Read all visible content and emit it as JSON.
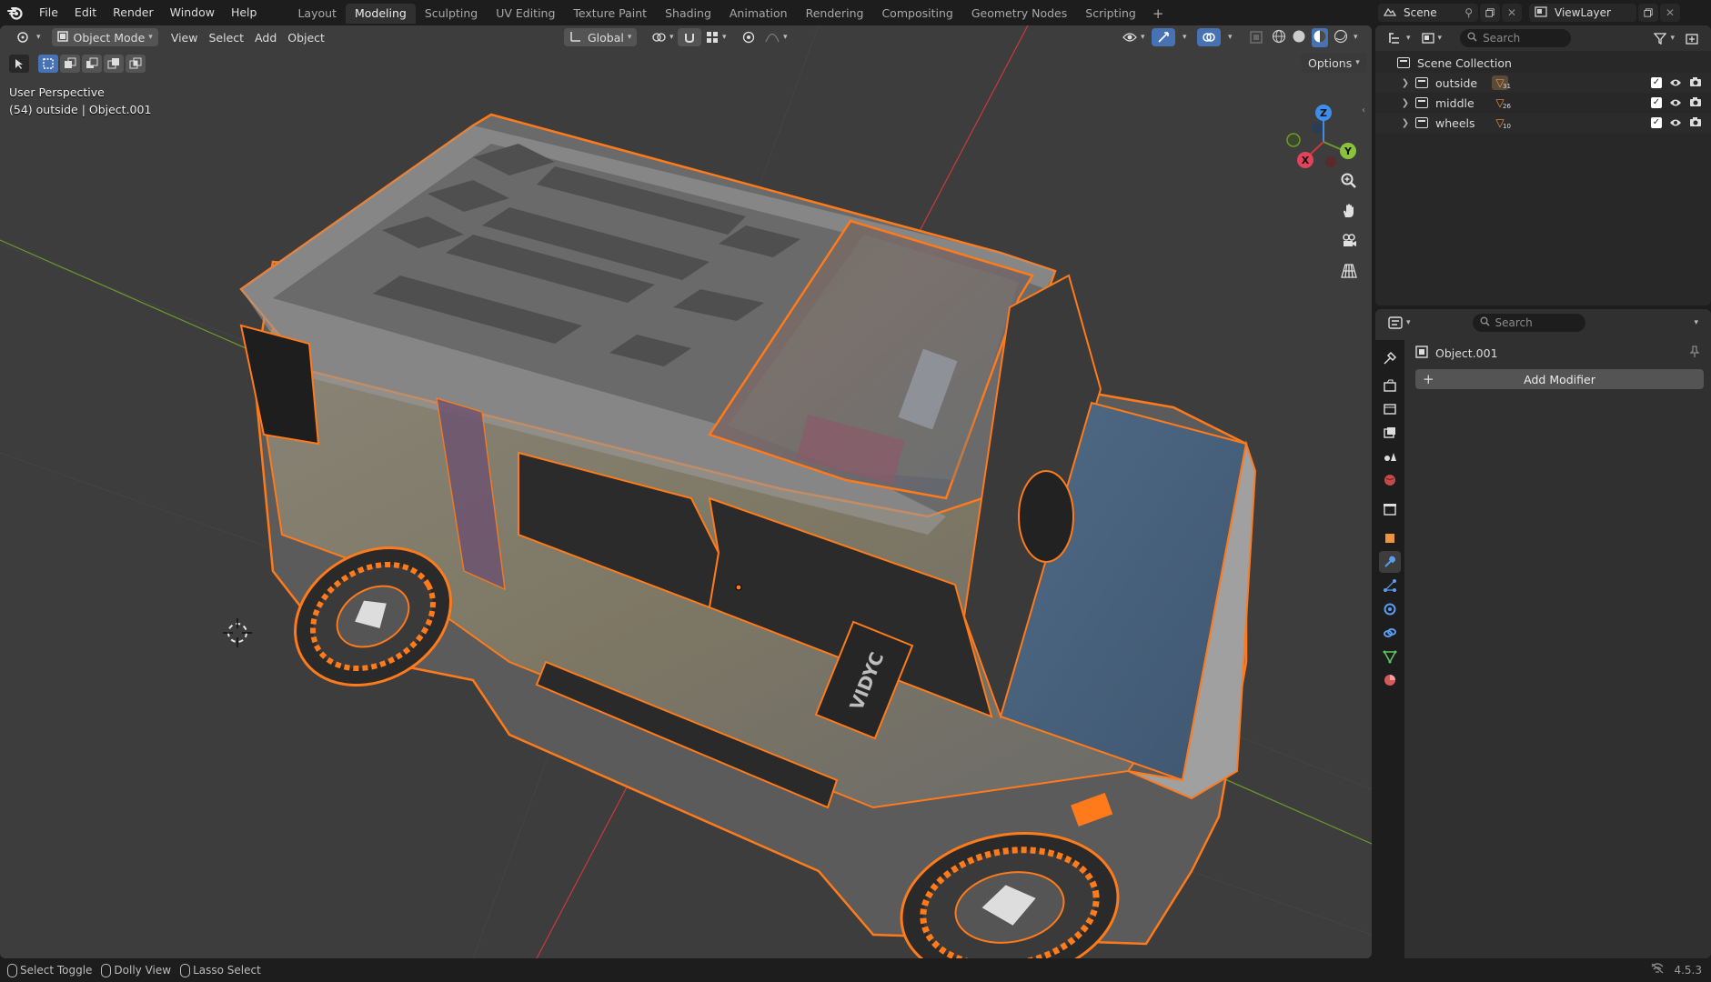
{
  "topbar": {
    "menus": [
      "File",
      "Edit",
      "Render",
      "Window",
      "Help"
    ],
    "workspaces": [
      "Layout",
      "Modeling",
      "Sculpting",
      "UV Editing",
      "Texture Paint",
      "Shading",
      "Animation",
      "Rendering",
      "Compositing",
      "Geometry Nodes",
      "Scripting"
    ],
    "active_workspace": "Modeling",
    "scene_name": "Scene",
    "view_layer": "ViewLayer"
  },
  "viewport": {
    "mode": "Object Mode",
    "menus": [
      "View",
      "Select",
      "Add",
      "Object"
    ],
    "transform_orientation": "Global",
    "options_label": "Options",
    "perspective_label": "User Perspective",
    "object_info": "(54) outside | Object.001",
    "gizmo_axes": [
      "Z",
      "Y",
      "X"
    ],
    "model_decal": "VIDYC",
    "colors": {
      "background": "#3d3d3d",
      "selection": "#ff7a1a",
      "x_axis": "#c93a3a",
      "y_axis": "#6d9a2a",
      "z_axis": "#3d8ee8"
    }
  },
  "outliner": {
    "search_placeholder": "Search",
    "root": "Scene Collection",
    "collections": [
      {
        "name": "outside",
        "count": "31"
      },
      {
        "name": "middle",
        "count": "26"
      },
      {
        "name": "wheels",
        "count": "10"
      }
    ]
  },
  "properties": {
    "search_placeholder": "Search",
    "object_name": "Object.001",
    "add_modifier_label": "Add Modifier"
  },
  "statusbar": {
    "items": [
      "Select Toggle",
      "Dolly View",
      "Lasso Select"
    ],
    "version": "4.5.3"
  }
}
